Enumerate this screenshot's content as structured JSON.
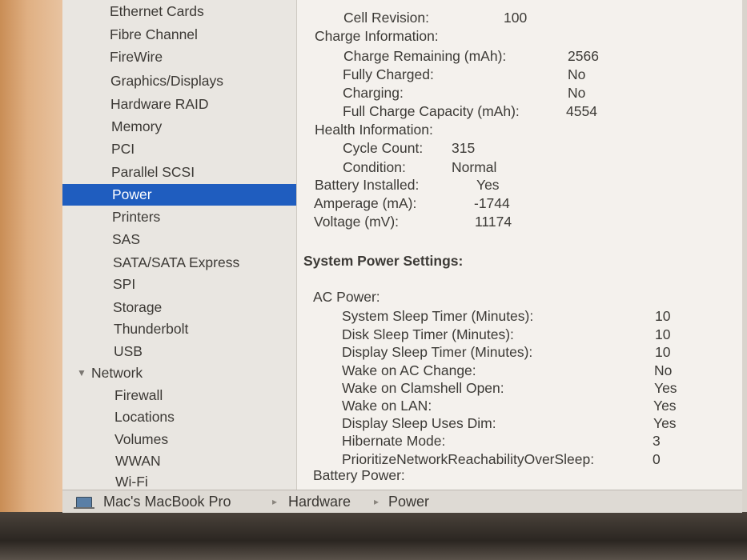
{
  "sidebar": {
    "items": [
      {
        "label": "Ethernet Cards"
      },
      {
        "label": "Fibre Channel"
      },
      {
        "label": "FireWire"
      },
      {
        "label": "Graphics/Displays"
      },
      {
        "label": "Hardware RAID"
      },
      {
        "label": "Memory"
      },
      {
        "label": "PCI"
      },
      {
        "label": "Parallel SCSI"
      },
      {
        "label": "Power"
      },
      {
        "label": "Printers"
      },
      {
        "label": "SAS"
      },
      {
        "label": "SATA/SATA Express"
      },
      {
        "label": "SPI"
      },
      {
        "label": "Storage"
      },
      {
        "label": "Thunderbolt"
      },
      {
        "label": "USB"
      },
      {
        "label": "Network"
      },
      {
        "label": "Firewall"
      },
      {
        "label": "Locations"
      },
      {
        "label": "Volumes"
      },
      {
        "label": "WWAN"
      },
      {
        "label": "Wi-Fi"
      }
    ],
    "selected": "Power"
  },
  "battery": {
    "cell_revision": {
      "label": "Cell Revision:",
      "value": "100"
    },
    "charge_heading": "Charge Information:",
    "charge_remaining": {
      "label": "Charge Remaining (mAh):",
      "value": "2566"
    },
    "fully_charged": {
      "label": "Fully Charged:",
      "value": "No"
    },
    "charging": {
      "label": "Charging:",
      "value": "No"
    },
    "full_charge_capacity": {
      "label": "Full Charge Capacity (mAh):",
      "value": "4554"
    },
    "health_heading": "Health Information:",
    "cycle_count": {
      "label": "Cycle Count:",
      "value": "315"
    },
    "condition": {
      "label": "Condition:",
      "value": "Normal"
    },
    "battery_installed": {
      "label": "Battery Installed:",
      "value": "Yes"
    },
    "amperage": {
      "label": "Amperage (mA):",
      "value": "-1744"
    },
    "voltage": {
      "label": "Voltage (mV):",
      "value": "11174"
    }
  },
  "power_settings": {
    "title": "System Power Settings:",
    "ac_heading": "AC Power:",
    "rows": [
      {
        "label": "System Sleep Timer (Minutes):",
        "value": "10"
      },
      {
        "label": "Disk Sleep Timer (Minutes):",
        "value": "10"
      },
      {
        "label": "Display Sleep Timer (Minutes):",
        "value": "10"
      },
      {
        "label": "Wake on AC Change:",
        "value": "No"
      },
      {
        "label": "Wake on Clamshell Open:",
        "value": "Yes"
      },
      {
        "label": "Wake on LAN:",
        "value": "Yes"
      },
      {
        "label": "Display Sleep Uses Dim:",
        "value": "Yes"
      },
      {
        "label": "Hibernate Mode:",
        "value": "3"
      },
      {
        "label": "PrioritizeNetworkReachabilityOverSleep:",
        "value": "0"
      }
    ],
    "battery_heading": "Battery Power:"
  },
  "statusbar": {
    "computer": "Mac's MacBook Pro",
    "crumb1": "Hardware",
    "crumb2": "Power",
    "separator": "▸"
  },
  "icons": {
    "disclosure": "▼"
  },
  "colors": {
    "selection": "#1f5dbf",
    "sidebar_bg": "#e9e6e1",
    "content_bg": "#f4f1ed"
  }
}
